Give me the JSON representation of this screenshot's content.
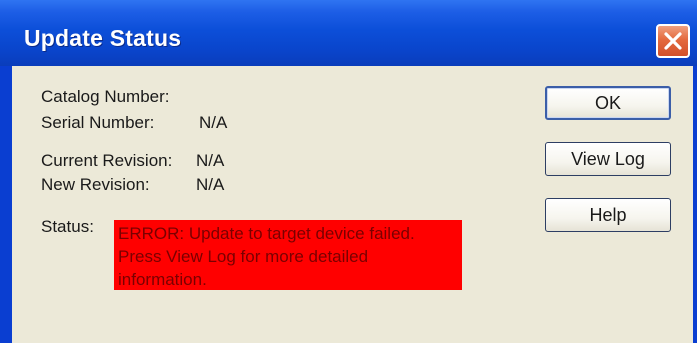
{
  "window": {
    "title": "Update Status"
  },
  "fields": {
    "catalog_number_label": "Catalog Number:",
    "serial_number_label": "Serial Number:",
    "serial_number_value": "N/A",
    "current_revision_label": "Current Revision:",
    "current_revision_value": "N/A",
    "new_revision_label": "New Revision:",
    "new_revision_value": "N/A",
    "status_label": "Status:",
    "status_message": "ERROR: Update to target device failed. Press View Log for more detailed information."
  },
  "buttons": {
    "ok": "OK",
    "view_log": "View Log",
    "help": "Help"
  },
  "colors": {
    "titlebar": "#0c4fd9",
    "dialog_bg": "#ece9d8",
    "error_bg": "#ff0000",
    "error_text": "#7a0000",
    "close_button": "#e46a3e"
  },
  "icons": {
    "close": "close-icon"
  }
}
